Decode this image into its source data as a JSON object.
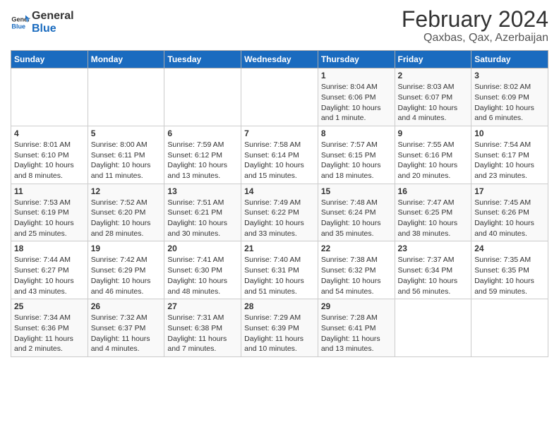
{
  "header": {
    "logo_line1": "General",
    "logo_line2": "Blue",
    "title": "February 2024",
    "subtitle": "Qaxbas, Qax, Azerbaijan"
  },
  "days_of_week": [
    "Sunday",
    "Monday",
    "Tuesday",
    "Wednesday",
    "Thursday",
    "Friday",
    "Saturday"
  ],
  "weeks": [
    [
      {
        "day": "",
        "info": ""
      },
      {
        "day": "",
        "info": ""
      },
      {
        "day": "",
        "info": ""
      },
      {
        "day": "",
        "info": ""
      },
      {
        "day": "1",
        "info": "Sunrise: 8:04 AM\nSunset: 6:06 PM\nDaylight: 10 hours\nand 1 minute."
      },
      {
        "day": "2",
        "info": "Sunrise: 8:03 AM\nSunset: 6:07 PM\nDaylight: 10 hours\nand 4 minutes."
      },
      {
        "day": "3",
        "info": "Sunrise: 8:02 AM\nSunset: 6:09 PM\nDaylight: 10 hours\nand 6 minutes."
      }
    ],
    [
      {
        "day": "4",
        "info": "Sunrise: 8:01 AM\nSunset: 6:10 PM\nDaylight: 10 hours\nand 8 minutes."
      },
      {
        "day": "5",
        "info": "Sunrise: 8:00 AM\nSunset: 6:11 PM\nDaylight: 10 hours\nand 11 minutes."
      },
      {
        "day": "6",
        "info": "Sunrise: 7:59 AM\nSunset: 6:12 PM\nDaylight: 10 hours\nand 13 minutes."
      },
      {
        "day": "7",
        "info": "Sunrise: 7:58 AM\nSunset: 6:14 PM\nDaylight: 10 hours\nand 15 minutes."
      },
      {
        "day": "8",
        "info": "Sunrise: 7:57 AM\nSunset: 6:15 PM\nDaylight: 10 hours\nand 18 minutes."
      },
      {
        "day": "9",
        "info": "Sunrise: 7:55 AM\nSunset: 6:16 PM\nDaylight: 10 hours\nand 20 minutes."
      },
      {
        "day": "10",
        "info": "Sunrise: 7:54 AM\nSunset: 6:17 PM\nDaylight: 10 hours\nand 23 minutes."
      }
    ],
    [
      {
        "day": "11",
        "info": "Sunrise: 7:53 AM\nSunset: 6:19 PM\nDaylight: 10 hours\nand 25 minutes."
      },
      {
        "day": "12",
        "info": "Sunrise: 7:52 AM\nSunset: 6:20 PM\nDaylight: 10 hours\nand 28 minutes."
      },
      {
        "day": "13",
        "info": "Sunrise: 7:51 AM\nSunset: 6:21 PM\nDaylight: 10 hours\nand 30 minutes."
      },
      {
        "day": "14",
        "info": "Sunrise: 7:49 AM\nSunset: 6:22 PM\nDaylight: 10 hours\nand 33 minutes."
      },
      {
        "day": "15",
        "info": "Sunrise: 7:48 AM\nSunset: 6:24 PM\nDaylight: 10 hours\nand 35 minutes."
      },
      {
        "day": "16",
        "info": "Sunrise: 7:47 AM\nSunset: 6:25 PM\nDaylight: 10 hours\nand 38 minutes."
      },
      {
        "day": "17",
        "info": "Sunrise: 7:45 AM\nSunset: 6:26 PM\nDaylight: 10 hours\nand 40 minutes."
      }
    ],
    [
      {
        "day": "18",
        "info": "Sunrise: 7:44 AM\nSunset: 6:27 PM\nDaylight: 10 hours\nand 43 minutes."
      },
      {
        "day": "19",
        "info": "Sunrise: 7:42 AM\nSunset: 6:29 PM\nDaylight: 10 hours\nand 46 minutes."
      },
      {
        "day": "20",
        "info": "Sunrise: 7:41 AM\nSunset: 6:30 PM\nDaylight: 10 hours\nand 48 minutes."
      },
      {
        "day": "21",
        "info": "Sunrise: 7:40 AM\nSunset: 6:31 PM\nDaylight: 10 hours\nand 51 minutes."
      },
      {
        "day": "22",
        "info": "Sunrise: 7:38 AM\nSunset: 6:32 PM\nDaylight: 10 hours\nand 54 minutes."
      },
      {
        "day": "23",
        "info": "Sunrise: 7:37 AM\nSunset: 6:34 PM\nDaylight: 10 hours\nand 56 minutes."
      },
      {
        "day": "24",
        "info": "Sunrise: 7:35 AM\nSunset: 6:35 PM\nDaylight: 10 hours\nand 59 minutes."
      }
    ],
    [
      {
        "day": "25",
        "info": "Sunrise: 7:34 AM\nSunset: 6:36 PM\nDaylight: 11 hours\nand 2 minutes."
      },
      {
        "day": "26",
        "info": "Sunrise: 7:32 AM\nSunset: 6:37 PM\nDaylight: 11 hours\nand 4 minutes."
      },
      {
        "day": "27",
        "info": "Sunrise: 7:31 AM\nSunset: 6:38 PM\nDaylight: 11 hours\nand 7 minutes."
      },
      {
        "day": "28",
        "info": "Sunrise: 7:29 AM\nSunset: 6:39 PM\nDaylight: 11 hours\nand 10 minutes."
      },
      {
        "day": "29",
        "info": "Sunrise: 7:28 AM\nSunset: 6:41 PM\nDaylight: 11 hours\nand 13 minutes."
      },
      {
        "day": "",
        "info": ""
      },
      {
        "day": "",
        "info": ""
      }
    ]
  ]
}
